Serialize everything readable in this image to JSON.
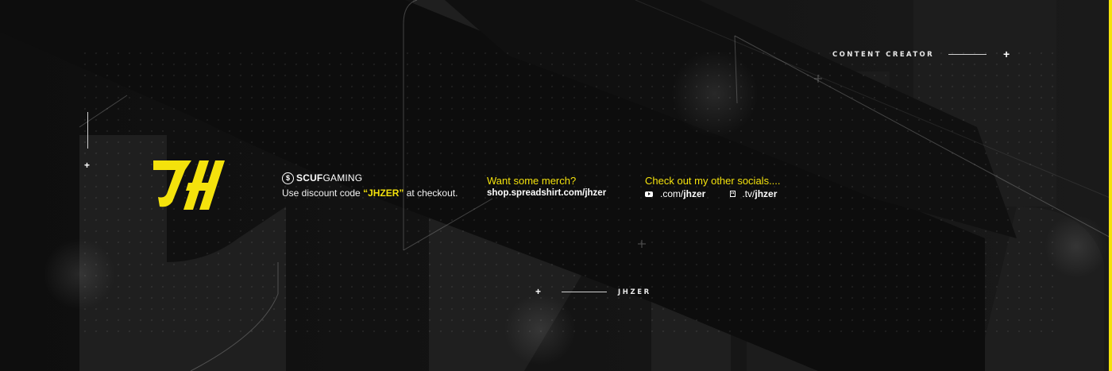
{
  "banner": {
    "tagline": "CONTENT CREATOR",
    "channel_name": "JHZER",
    "accent_color": "#f4e20c",
    "background_color": "#151515"
  },
  "logo": {
    "icon": "jh-monogram-logo"
  },
  "sponsor": {
    "icon": "scuf-dollar-icon",
    "brand_bold": "SCUF",
    "brand_light": "GAMING",
    "discount_prefix": "Use discount code ",
    "discount_code": "“JHZER”",
    "discount_suffix": " at checkout."
  },
  "merch": {
    "heading": "Want some merch?",
    "url": "shop.spreadshirt.com/jhzer"
  },
  "socials": {
    "heading": "Check out my other socials....",
    "items": [
      {
        "icon": "youtube-icon",
        "prefix": ".com/",
        "handle": "jhzer"
      },
      {
        "icon": "twitch-icon",
        "prefix": ".tv/",
        "handle": "jhzer"
      }
    ]
  }
}
